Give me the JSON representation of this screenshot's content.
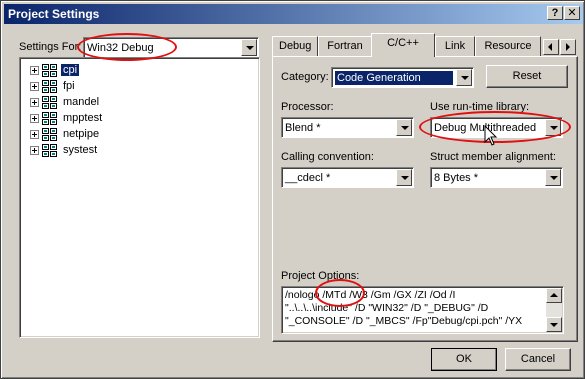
{
  "window": {
    "title": "Project Settings",
    "help_btn": "?",
    "close_btn": "✕"
  },
  "settings_for": {
    "label": "Settings For:",
    "value": "Win32 Debug"
  },
  "tree": {
    "items": [
      {
        "name": "cpi",
        "selected": true
      },
      {
        "name": "fpi",
        "selected": false
      },
      {
        "name": "mandel",
        "selected": false
      },
      {
        "name": "mpptest",
        "selected": false
      },
      {
        "name": "netpipe",
        "selected": false
      },
      {
        "name": "systest",
        "selected": false
      }
    ]
  },
  "tabs": [
    "Debug",
    "Fortran",
    "C/C++",
    "Link",
    "Resource"
  ],
  "active_tab": "C/C++",
  "category": {
    "label": "Category:",
    "value": "Code Generation"
  },
  "reset_label": "Reset",
  "processor": {
    "label": "Processor:",
    "value": "Blend *"
  },
  "runtime": {
    "label": "Use run-time library:",
    "value": "Debug Multithreaded"
  },
  "calling": {
    "label": "Calling convention:",
    "value": "__cdecl *"
  },
  "struct": {
    "label": "Struct member alignment:",
    "value": "8 Bytes *"
  },
  "options": {
    "label": "Project Options:",
    "line1": "/nologo /MTd /W3 /Gm /GX /ZI /Od /I",
    "line2": "\"..\\..\\..\\include\" /D \"WIN32\" /D \"_DEBUG\" /D",
    "line3": "\"_CONSOLE\" /D \"_MBCS\" /Fp\"Debug/cpi.pch\" /YX"
  },
  "ok_label": "OK",
  "cancel_label": "Cancel",
  "colors": {
    "title_start": "#0a246a",
    "title_end": "#a6caf0",
    "face": "#d4d0c8",
    "selection": "#0a246a",
    "annotation": "#e01010"
  }
}
